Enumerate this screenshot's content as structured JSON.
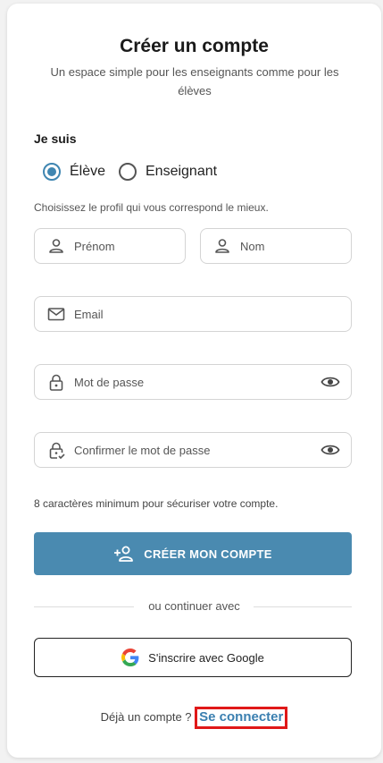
{
  "header": {
    "title": "Créer un compte",
    "subtitle": "Un espace simple pour les enseignants comme pour les élèves"
  },
  "role": {
    "label": "Je suis",
    "options": [
      "Élève",
      "Enseignant"
    ],
    "selected": "Élève",
    "hint": "Choisissez le profil qui vous correspond le mieux."
  },
  "form": {
    "firstname_placeholder": "Prénom",
    "lastname_placeholder": "Nom",
    "email_placeholder": "Email",
    "password_placeholder": "Mot de passe",
    "confirm_placeholder": "Confirmer le mot de passe",
    "password_hint": "8 caractères minimum pour sécuriser votre compte."
  },
  "actions": {
    "create_label": "CRÉER MON COMPTE",
    "divider": "ou continuer avec",
    "google_label": "S'inscrire avec Google"
  },
  "footer": {
    "prompt": "Déjà un compte ?",
    "link": "Se connecter"
  },
  "colors": {
    "accent": "#4a8ab0",
    "link": "#3a7fb0",
    "highlight": "#e01818"
  }
}
